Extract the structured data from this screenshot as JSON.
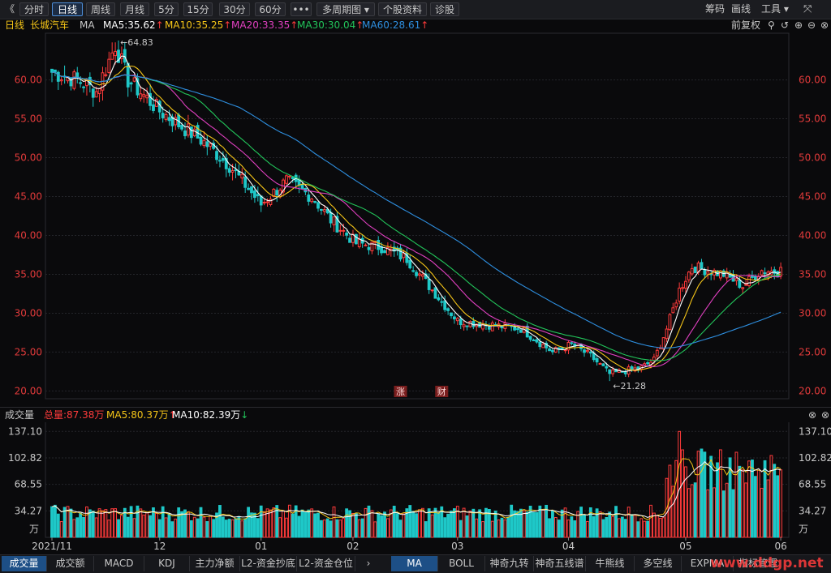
{
  "toolbar": {
    "back_icon": "double-chevron-left-icon",
    "tabs": [
      "分时",
      "日线",
      "周线",
      "月线",
      "5分",
      "15分",
      "30分",
      "60分"
    ],
    "active_tab": "日线",
    "more": "•••",
    "multi_period": "多周期图",
    "stock_info": "个股资料",
    "diagnose": "诊股",
    "right": [
      "筹码",
      "画线",
      "工具"
    ],
    "expand_icon": "expand-arrows-icon"
  },
  "header": {
    "period": "日线",
    "stock_name": "长城汽车",
    "ma_label": "MA",
    "ma5": "MA5:35.62",
    "ma10": "MA10:35.25",
    "ma20": "MA20:33.35",
    "ma30": "MA30:30.04",
    "ma60": "MA60:28.61",
    "adjust": "前复权",
    "colors": {
      "ma5": "#ffffff",
      "ma10": "#f5c518",
      "ma20": "#e040c0",
      "ma30": "#22c45a",
      "ma60": "#2e8fe0",
      "up": "#ff3b3b",
      "down": "#1ec8c8"
    }
  },
  "volume_header": {
    "label": "成交量",
    "total": "总量:87.38万",
    "ma5": "MA5:80.37万",
    "ma10": "MA10:82.39万"
  },
  "chart_data": {
    "type": "candlestick",
    "price_axis": {
      "ylim": [
        19,
        66
      ],
      "ticks": [
        "60.00",
        "55.00",
        "50.00",
        "45.00",
        "40.00",
        "35.00",
        "30.00",
        "25.00",
        "20.00"
      ]
    },
    "volume_axis": {
      "ylim": [
        0,
        150
      ],
      "ticks": [
        "137.10",
        "102.82",
        "68.55",
        "34.27"
      ],
      "unit": "万"
    },
    "x_ticks": [
      "2021/11",
      "12",
      "01",
      "02",
      "03",
      "04",
      "05",
      "06"
    ],
    "annotations": {
      "high": "64.83",
      "low": "21.28",
      "events": [
        "涨",
        "财"
      ]
    },
    "anchors": [
      [
        0,
        61
      ],
      [
        8,
        60
      ],
      [
        14,
        58.5
      ],
      [
        20,
        64.5
      ],
      [
        24,
        60
      ],
      [
        34,
        56
      ],
      [
        48,
        52
      ],
      [
        56,
        49
      ],
      [
        66,
        44
      ],
      [
        74,
        47
      ],
      [
        82,
        45
      ],
      [
        88,
        42
      ],
      [
        96,
        39
      ],
      [
        104,
        38.5
      ],
      [
        112,
        37
      ],
      [
        118,
        34
      ],
      [
        128,
        29
      ],
      [
        138,
        28.5
      ],
      [
        148,
        28
      ],
      [
        158,
        25
      ],
      [
        164,
        26
      ],
      [
        170,
        24.5
      ],
      [
        176,
        22.2
      ],
      [
        180,
        22.5
      ],
      [
        186,
        23
      ],
      [
        190,
        24
      ],
      [
        194,
        28
      ],
      [
        198,
        33
      ],
      [
        202,
        36
      ],
      [
        212,
        35
      ],
      [
        218,
        33.5
      ],
      [
        224,
        35.5
      ],
      [
        230,
        35.3
      ]
    ],
    "ma5_last": 35.62,
    "ma10_last": 35.25,
    "ma20_last": 33.35,
    "ma30_last": 30.04,
    "ma60_last": 28.61,
    "volume_total_last": 87.38,
    "volume_ma5_last": 80.37,
    "volume_ma10_last": 82.39,
    "grid": true
  },
  "bottom_tabs_left": [
    "成交量",
    "成交额",
    "MACD",
    "KDJ",
    "主力净额",
    "L2-资金抄底",
    "L2-资金仓位"
  ],
  "bottom_tabs_right": [
    "MA",
    "BOLL",
    "神奇九转",
    "神奇五线谱",
    "牛熊线",
    "多空线",
    "EXPMA",
    "指标管理"
  ],
  "watermark": "www.ddgp.net"
}
